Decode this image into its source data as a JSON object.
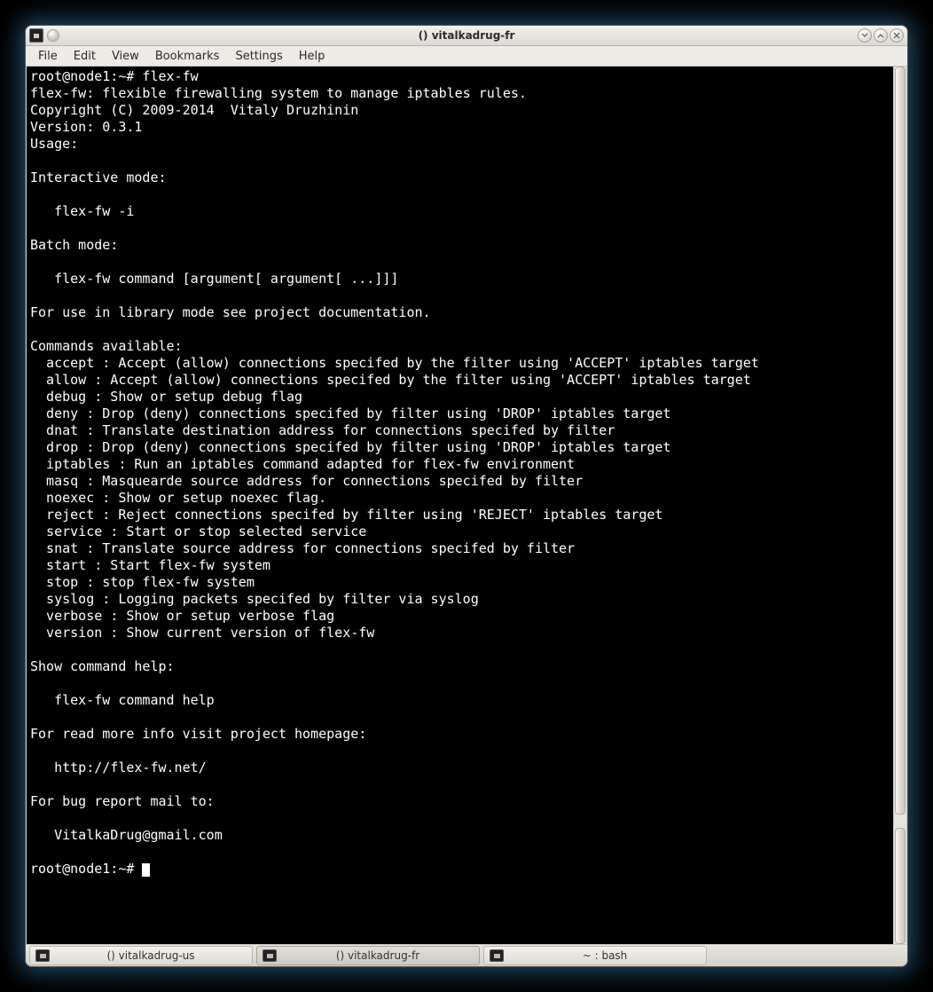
{
  "window": {
    "title": "() vitalkadrug-fr"
  },
  "menubar": {
    "items": [
      "File",
      "Edit",
      "View",
      "Bookmarks",
      "Settings",
      "Help"
    ]
  },
  "terminal": {
    "lines": [
      "root@node1:~# flex-fw",
      "flex-fw: flexible firewalling system to manage iptables rules.",
      "Copyright (C) 2009-2014  Vitaly Druzhinin",
      "Version: 0.3.1",
      "Usage:",
      "",
      "Interactive mode:",
      "",
      "   flex-fw -i",
      "",
      "Batch mode:",
      "",
      "   flex-fw command [argument[ argument[ ...]]]",
      "",
      "For use in library mode see project documentation.",
      "",
      "Commands available:",
      "  accept : Accept (allow) connections specifed by the filter using 'ACCEPT' iptables target",
      "  allow : Accept (allow) connections specifed by the filter using 'ACCEPT' iptables target",
      "  debug : Show or setup debug flag",
      "  deny : Drop (deny) connections specifed by filter using 'DROP' iptables target",
      "  dnat : Translate destination address for connections specifed by filter",
      "  drop : Drop (deny) connections specifed by filter using 'DROP' iptables target",
      "  iptables : Run an iptables command adapted for flex-fw environment",
      "  masq : Masquearde source address for connections specifed by filter",
      "  noexec : Show or setup noexec flag.",
      "  reject : Reject connections specifed by filter using 'REJECT' iptables target",
      "  service : Start or stop selected service",
      "  snat : Translate source address for connections specifed by filter",
      "  start : Start flex-fw system",
      "  stop : stop flex-fw system",
      "  syslog : Logging packets specifed by filter via syslog",
      "  verbose : Show or setup verbose flag",
      "  version : Show current version of flex-fw",
      "",
      "Show command help:",
      "",
      "   flex-fw command help",
      "",
      "For read more info visit project homepage:",
      "",
      "   http://flex-fw.net/",
      "",
      "For bug report mail to:",
      "",
      "   VitalkaDrug@gmail.com",
      ""
    ],
    "prompt": "root@node1:~# "
  },
  "taskbar": {
    "items": [
      {
        "label": "() vitalkadrug-us",
        "active": false
      },
      {
        "label": "() vitalkadrug-fr",
        "active": true
      },
      {
        "label": "~ : bash",
        "active": false
      }
    ]
  }
}
